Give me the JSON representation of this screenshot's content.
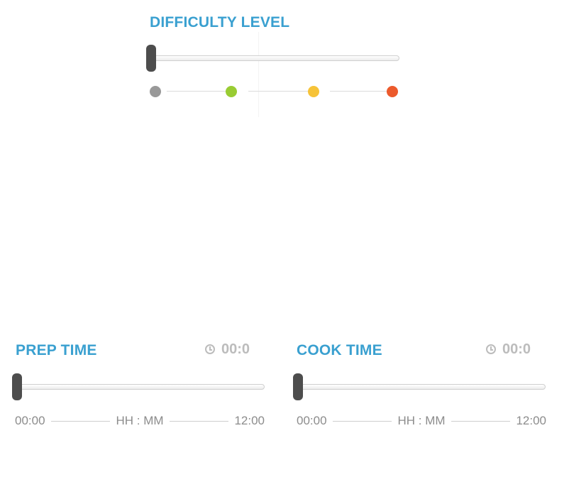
{
  "difficulty": {
    "title": "DIFFICULTY LEVEL",
    "slider_value": 0,
    "levels": [
      {
        "color": "#999999"
      },
      {
        "color": "#99cc33"
      },
      {
        "color": "#f6c338"
      },
      {
        "color": "#ec5a2c"
      }
    ]
  },
  "prep": {
    "title": "PREP TIME",
    "readout": "00:0",
    "slider_value": 0,
    "scale_min": "00:00",
    "scale_unit": "HH : MM",
    "scale_max": "12:00"
  },
  "cook": {
    "title": "COOK TIME",
    "readout": "00:0",
    "slider_value": 0,
    "scale_min": "00:00",
    "scale_unit": "HH : MM",
    "scale_max": "12:00"
  },
  "colors": {
    "title_blue": "#3aa0d0",
    "handle": "#4d4d4d",
    "readout_gray": "#bcbcbc"
  }
}
